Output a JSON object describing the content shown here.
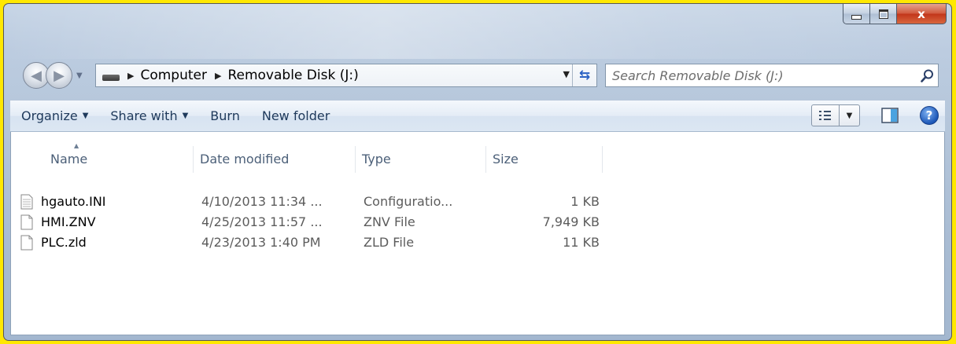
{
  "window": {
    "close_glyph": "x"
  },
  "address_bar": {
    "crumbs": [
      "Computer",
      "Removable Disk (J:)"
    ]
  },
  "search": {
    "placeholder": "Search Removable Disk (J:)"
  },
  "command_bar": {
    "organize": "Organize",
    "share_with": "Share with",
    "burn": "Burn",
    "new_folder": "New folder"
  },
  "columns": {
    "name": "Name",
    "date_modified": "Date modified",
    "type": "Type",
    "size": "Size"
  },
  "files": [
    {
      "name": "hgauto.INI",
      "date": "4/10/2013 11:34 ...",
      "type": "Configuratio...",
      "size": "1 KB",
      "icon": "config-file-icon"
    },
    {
      "name": "HMI.ZNV",
      "date": "4/25/2013 11:57 ...",
      "type": "ZNV File",
      "size": "7,949 KB",
      "icon": "file-icon"
    },
    {
      "name": "PLC.zld",
      "date": "4/23/2013 1:40 PM",
      "type": "ZLD File",
      "size": "11 KB",
      "icon": "file-icon"
    }
  ],
  "colors": {
    "background_highlight": "#ffe800",
    "command_text": "#1e395b"
  }
}
